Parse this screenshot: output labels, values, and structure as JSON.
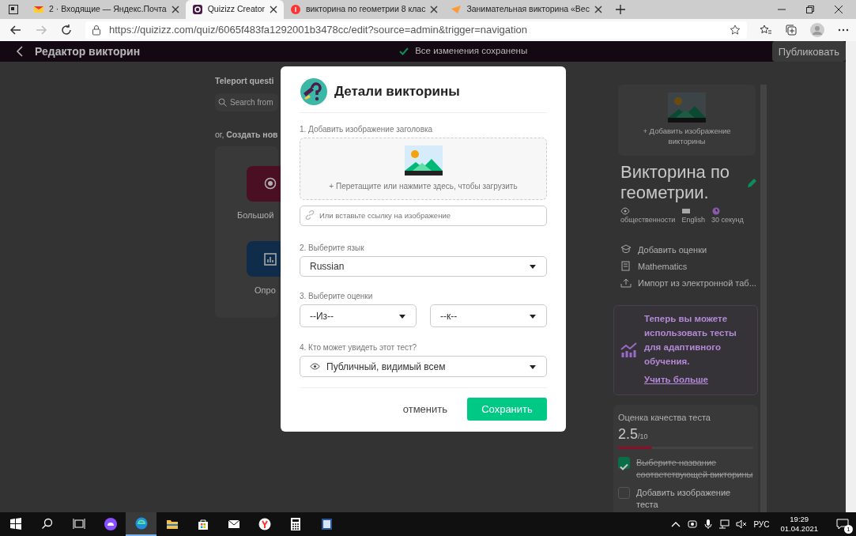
{
  "browser": {
    "tabs": [
      {
        "kind": "mail",
        "label": "2 · Входящие — Яндекс.Почта",
        "selected": false
      },
      {
        "kind": "quizizz",
        "label": "Quizizz Creator",
        "selected": true
      },
      {
        "kind": "yandex",
        "label": "викторина по геометрии 8 клас",
        "selected": false
      },
      {
        "kind": "paper",
        "label": "Занимательная викторина «Вес",
        "selected": false
      }
    ],
    "url": "https://quizizz.com/quiz/6065f483fa1292001b3478cc/edit?source=admin&trigger=navigation"
  },
  "header": {
    "title": "Редактор викторин",
    "save_status": "Все изменения сохранены",
    "publish": "Публиковать"
  },
  "editor": {
    "teleport_label": "Teleport questi",
    "search_placeholder": "Search from",
    "create_label": "ог, **Создать нов**",
    "tiles": [
      {
        "kind": "multiple-choice",
        "label": "Большой"
      },
      {
        "kind": "poll",
        "label": "Опро"
      }
    ]
  },
  "side_panel": {
    "image_prompt": "+ Добавить изображение викторины",
    "title": "Викторина по геометрии.",
    "meta": [
      {
        "kind": "visibility",
        "text": "общественности"
      },
      {
        "kind": "language",
        "text": "English"
      },
      {
        "kind": "time",
        "text": "30 секунд"
      }
    ],
    "actions": [
      {
        "kind": "grade",
        "text": "Добавить оценки"
      },
      {
        "kind": "subject",
        "text": "Mathematics"
      },
      {
        "kind": "import",
        "text": "Импорт из электронной таб..."
      }
    ],
    "promo": {
      "text": "Теперь вы можете использовать тесты для адаптивного обучения.",
      "link": "Учить больше"
    },
    "quality": {
      "label": "Оценка качества теста",
      "score": "2.5",
      "max": "/10",
      "level": 0.25,
      "checklist": [
        {
          "text": "Выберите название соответствующей викторины",
          "checked": true
        },
        {
          "text": "Добавить изображение теста",
          "checked": false
        }
      ]
    }
  },
  "modal": {
    "title": "Детали викторины",
    "image_label": "1. Добавить изображение заголовка",
    "dropzone_text": "+ Перетащите или нажмите здесь, чтобы загрузить",
    "link_placeholder": "Или вставьте ссылку на изображение",
    "language_label": "2. Выберите язык",
    "language": "Russian",
    "grades_label": "3. Выберите оценки",
    "grade_from": "--Из--",
    "grade_to": "--к--",
    "visibility_label": "4. Кто может увидеть этот тест?",
    "visibility": "Публичный, видимый всем",
    "cancel": "отменить",
    "save": "Сохранить"
  },
  "taskbar": {
    "apps": [
      {
        "kind": "start",
        "selected": false
      },
      {
        "kind": "search",
        "selected": false
      },
      {
        "kind": "task-view",
        "selected": false
      },
      {
        "kind": "assistant",
        "selected": false
      },
      {
        "kind": "browser",
        "selected": true
      },
      {
        "kind": "folder",
        "selected": false
      },
      {
        "kind": "store",
        "selected": false
      },
      {
        "kind": "mail",
        "selected": false
      },
      {
        "kind": "yandex",
        "selected": false
      },
      {
        "kind": "calculator",
        "selected": false
      },
      {
        "kind": "document",
        "selected": false
      }
    ],
    "tray": {
      "language": "РУС",
      "time": "19:29",
      "date": "01.04.2021",
      "notifications": "1"
    }
  }
}
